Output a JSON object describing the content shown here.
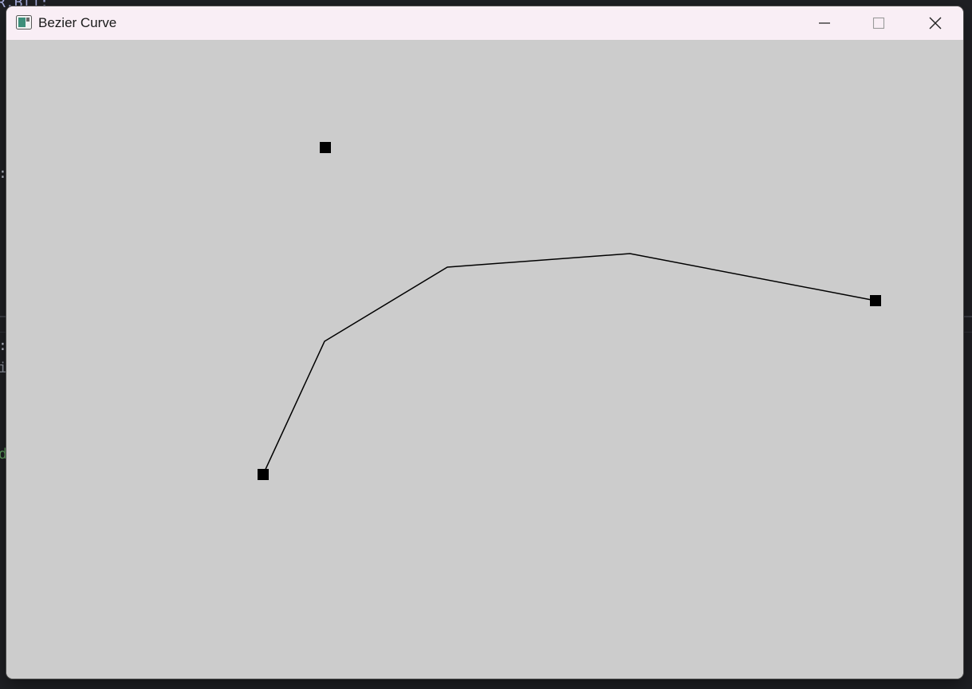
{
  "window": {
    "title": "Bezier Curve",
    "app_icon": "window-app-icon",
    "controls": {
      "minimize_icon": "minimize-icon",
      "maximize_icon": "maximize-icon",
      "close_icon": "close-icon"
    }
  },
  "background_editor": {
    "line1": "R,B[];",
    "line2": ":",
    "line3": ":",
    "line4": "i",
    "line5": "d"
  },
  "colors": {
    "canvas_background": "#cccccc",
    "titlebar_background": "#f9eef5",
    "curve_stroke": "#000000",
    "control_point_fill": "#000000"
  }
}
